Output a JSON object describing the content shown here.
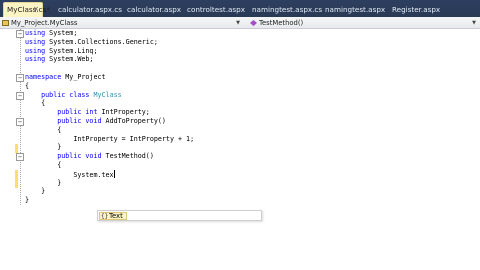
{
  "tabs": [
    {
      "label": "MyClass.cs*",
      "active": true,
      "closable": true
    },
    {
      "label": "calculator.aspx.cs",
      "active": false
    },
    {
      "label": "calculator.aspx",
      "active": false
    },
    {
      "label": "controltest.aspx",
      "active": false
    },
    {
      "label": "namingtest.aspx.cs",
      "active": false
    },
    {
      "label": "namingtest.aspx",
      "active": false
    },
    {
      "label": "Register.aspx",
      "active": false
    }
  ],
  "close_glyph": "×",
  "navbar": {
    "type_combo": "My_Project.MyClass",
    "member_combo": "TestMethod()"
  },
  "code_lines": [
    [
      {
        "k": "kw",
        "t": "using"
      },
      {
        "k": "",
        "t": " System;"
      }
    ],
    [
      {
        "k": "kw",
        "t": "using"
      },
      {
        "k": "",
        "t": " System.Collections.Generic;"
      }
    ],
    [
      {
        "k": "kw",
        "t": "using"
      },
      {
        "k": "",
        "t": " System.Linq;"
      }
    ],
    [
      {
        "k": "kw",
        "t": "using"
      },
      {
        "k": "",
        "t": " System.Web;"
      }
    ],
    [],
    [
      {
        "k": "kw",
        "t": "namespace"
      },
      {
        "k": "",
        "t": " My_Project"
      }
    ],
    [
      {
        "k": "",
        "t": "{"
      }
    ],
    [
      {
        "k": "",
        "t": "    "
      },
      {
        "k": "kw",
        "t": "public class"
      },
      {
        "k": "",
        "t": " "
      },
      {
        "k": "ty",
        "t": "MyClass"
      }
    ],
    [
      {
        "k": "",
        "t": "    {"
      }
    ],
    [
      {
        "k": "",
        "t": "        "
      },
      {
        "k": "kw",
        "t": "public int"
      },
      {
        "k": "",
        "t": " IntProperty;"
      }
    ],
    [
      {
        "k": "",
        "t": "        "
      },
      {
        "k": "kw",
        "t": "public void"
      },
      {
        "k": "",
        "t": " AddToProperty()"
      }
    ],
    [
      {
        "k": "",
        "t": "        {"
      }
    ],
    [
      {
        "k": "",
        "t": "            IntProperty = IntProperty + 1;"
      }
    ],
    [
      {
        "k": "",
        "t": "        }"
      }
    ],
    [
      {
        "k": "",
        "t": "        "
      },
      {
        "k": "kw",
        "t": "public void"
      },
      {
        "k": "",
        "t": " TestMethod()"
      }
    ],
    [
      {
        "k": "",
        "t": "        {"
      }
    ],
    [
      {
        "k": "",
        "t": "            System.tex"
      },
      {
        "k": "caret",
        "t": ""
      }
    ],
    [
      {
        "k": "",
        "t": "        }"
      }
    ],
    [
      {
        "k": "",
        "t": "    }"
      }
    ],
    [
      {
        "k": "",
        "t": "}"
      }
    ]
  ],
  "fold_glyph": "−",
  "intellisense": {
    "icon": "{}",
    "selected_item": "Text"
  },
  "colors": {
    "keyword": "#0000ff",
    "type": "#2b91af",
    "tab_strip": "#2d3f5f",
    "active_tab": "#fdf4c6",
    "change_bar": "#f7e16a"
  },
  "icons": {
    "type_combo": "class-icon",
    "member_combo": "method-icon",
    "intellisense_item": "namespace-icon"
  }
}
